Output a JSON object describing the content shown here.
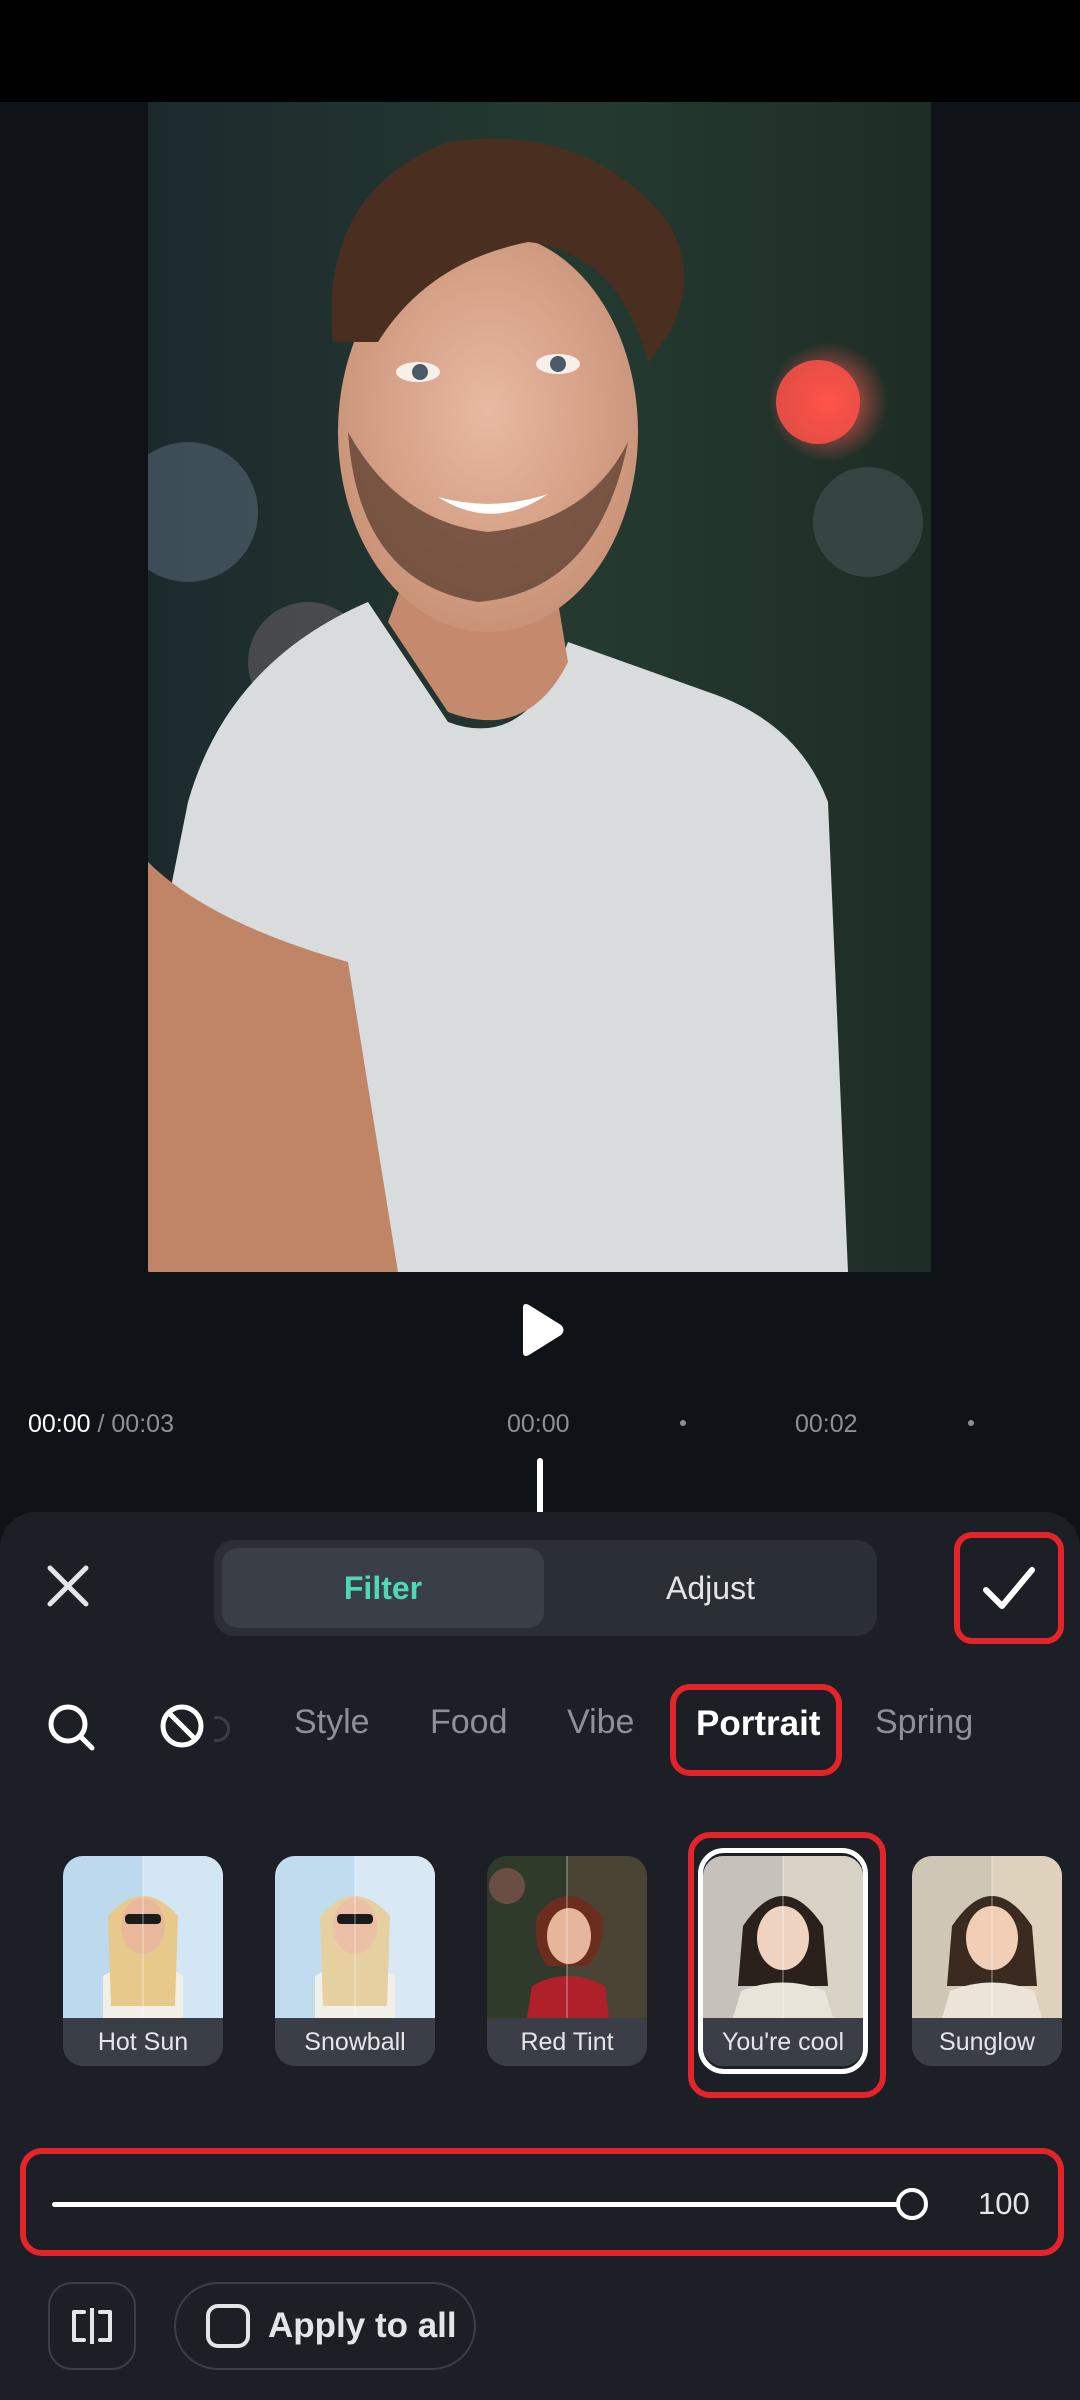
{
  "timeline": {
    "current": "00:00",
    "total": "/ 00:03",
    "ticks": [
      "00:00",
      "00:02"
    ]
  },
  "tabs": {
    "filter": "Filter",
    "adjust": "Adjust"
  },
  "categories": [
    "Style",
    "Food",
    "Vibe",
    "Portrait",
    "Spring"
  ],
  "filters": [
    "Hot Sun",
    "Snowball",
    "Red Tint",
    "You're cool",
    "Sunglow"
  ],
  "selected_filter": "You're cool",
  "intensity": {
    "value": 100,
    "label": "100"
  },
  "apply_to_all": "Apply to all",
  "colors": {
    "accent": "#4fd8b6",
    "highlight": "#e3242b"
  }
}
